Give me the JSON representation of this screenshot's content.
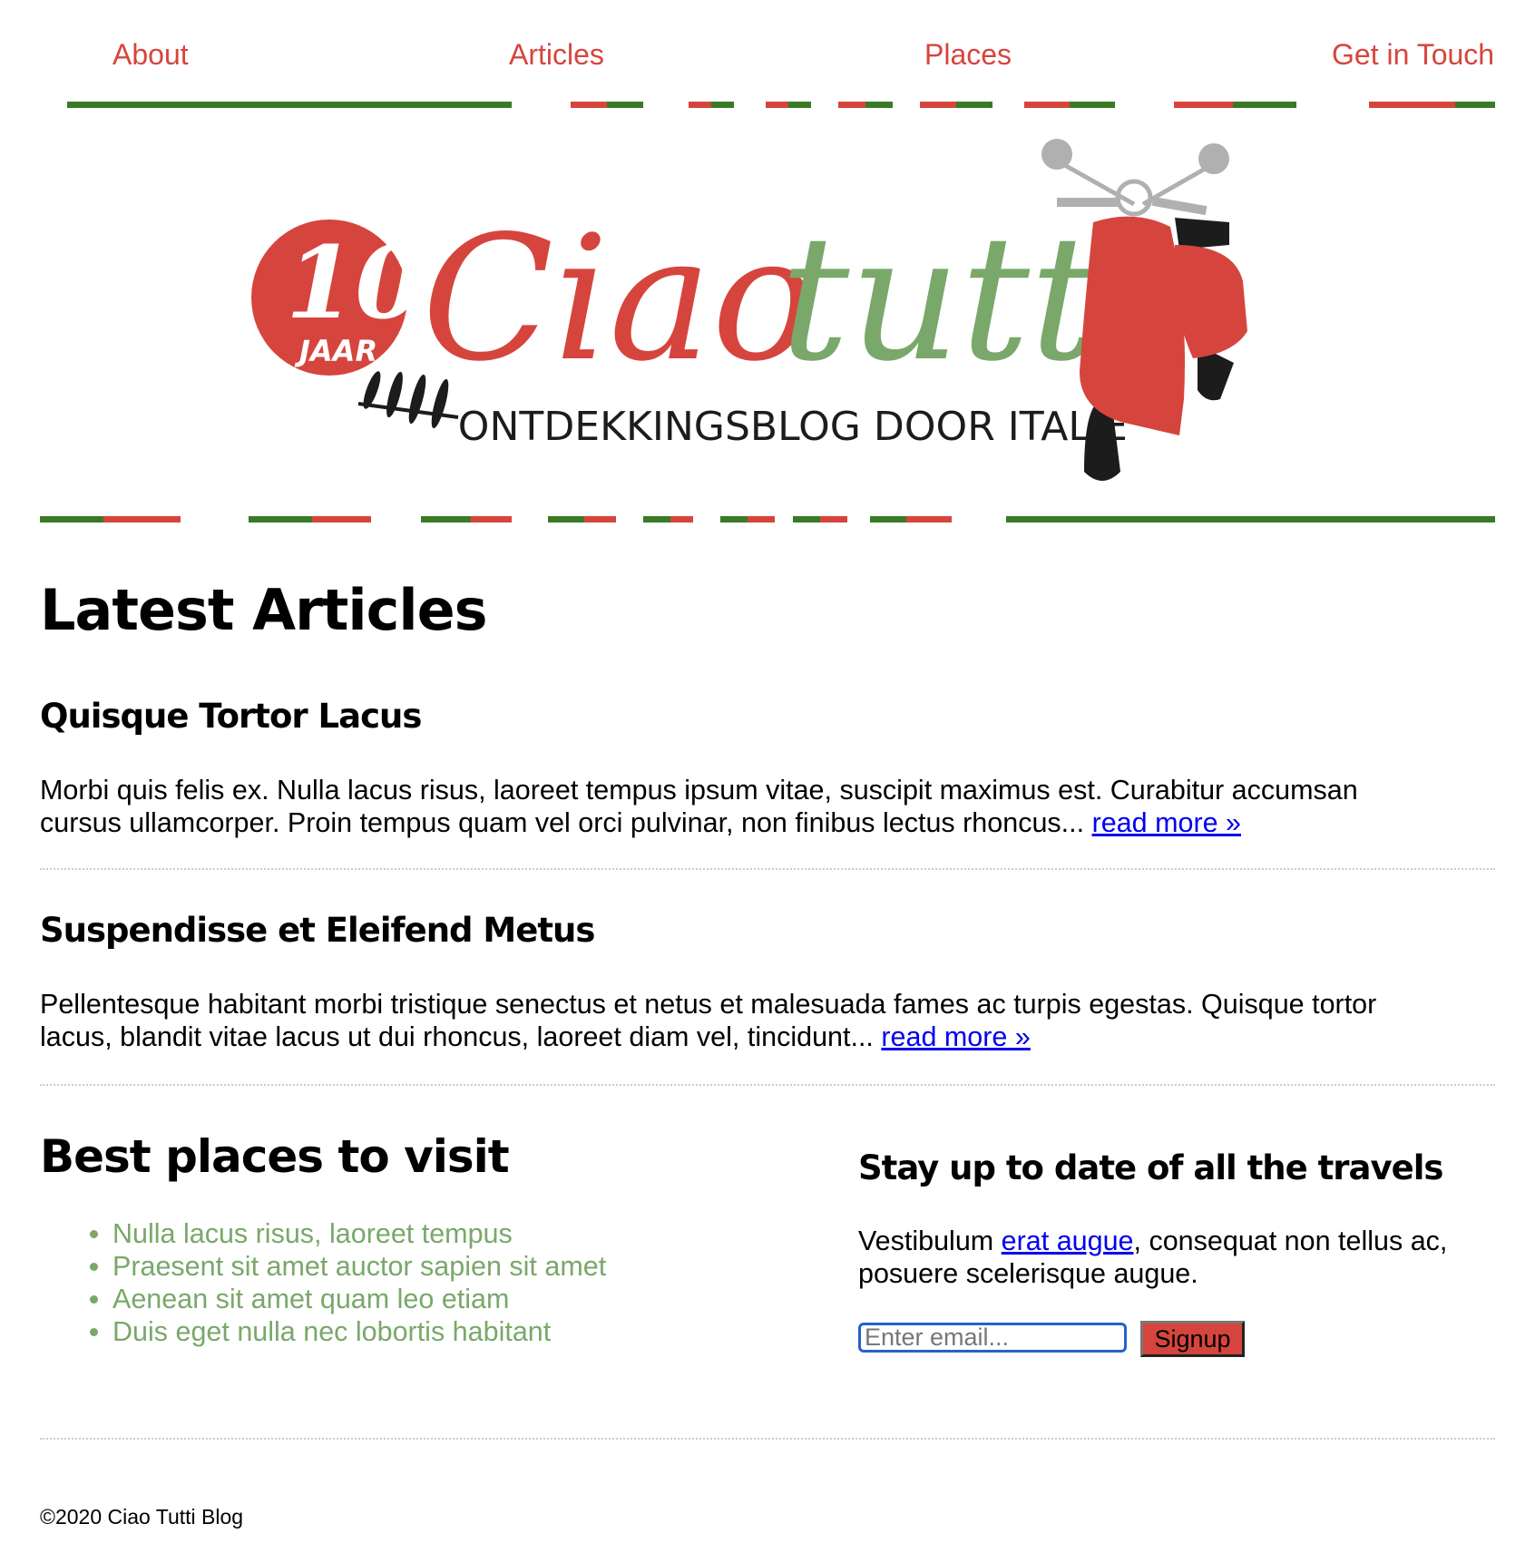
{
  "nav": {
    "items": [
      {
        "label": "About"
      },
      {
        "label": "Articles"
      },
      {
        "label": "Places"
      },
      {
        "label": "Get in Touch"
      }
    ]
  },
  "banner": {
    "badge_number": "10",
    "badge_label": "JAAR",
    "title_red": "Ciao",
    "title_green": "tutti",
    "tagline": "ONTDEKKINGSBLOG DOOR ITALIË",
    "colors": {
      "red": "#d6453d",
      "green": "#79a86a",
      "stripe_green": "#3a7a25"
    }
  },
  "main": {
    "title": "Latest Articles",
    "articles": [
      {
        "title": "Quisque Tortor Lacus",
        "line1": "Morbi quis felis ex. Nulla lacus risus, laoreet tempus ipsum vitae, suscipit maximus est. Curabitur accumsan",
        "line2": "cursus ullamcorper. Proin tempus quam vel orci pulvinar, non finibus lectus rhoncus... ",
        "read_more": "read more »"
      },
      {
        "title": "Suspendisse et Eleifend Metus",
        "line1": "Pellentesque habitant morbi tristique senectus et netus et malesuada fames ac turpis egestas. Quisque tortor",
        "line2": "lacus, blandit vitae lacus ut dui rhoncus, laoreet diam vel, tincidunt... ",
        "read_more": "read more »"
      }
    ]
  },
  "places": {
    "title": "Best places to visit",
    "items": [
      "Nulla lacus risus, laoreet tempus",
      "Praesent sit amet auctor sapien sit amet",
      "Aenean sit amet quam leo etiam",
      "Duis eget nulla nec lobortis habitant"
    ]
  },
  "newsletter": {
    "title": "Stay up to date of all the travels",
    "text_before": "Vestibulum ",
    "link": "erat augue",
    "text_after": ", consequat non tellus ac, posuere scelerisque augue.",
    "email_placeholder": "Enter email...",
    "signup_label": "Signup"
  },
  "footer": {
    "copyright": "©2020 Ciao Tutti Blog"
  }
}
